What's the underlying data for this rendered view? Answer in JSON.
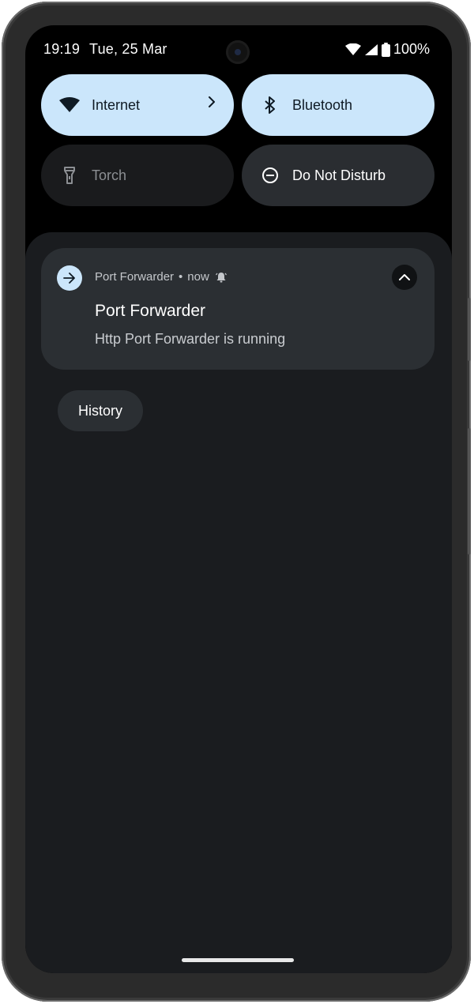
{
  "status_bar": {
    "time": "19:19",
    "date": "Tue, 25 Mar",
    "battery": "100%",
    "icons": [
      "wifi-icon",
      "cellular-signal-icon",
      "battery-icon"
    ]
  },
  "quick_tiles": [
    {
      "label": "Internet",
      "icon": "wifi-icon",
      "state": "on",
      "has_chevron": true
    },
    {
      "label": "Bluetooth",
      "icon": "bluetooth-icon",
      "state": "on"
    },
    {
      "label": "Torch",
      "icon": "torch-icon",
      "state": "off"
    },
    {
      "label": "Do Not Disturb",
      "icon": "dnd-icon",
      "state": "off"
    }
  ],
  "notification": {
    "app_name": "Port Forwarder",
    "separator": "•",
    "time": "now",
    "title": "Port Forwarder",
    "text": "Http Port Forwarder is running",
    "app_icon": "arrow-right-icon",
    "header_icon": "alert-bell-icon",
    "expand_icon": "chevron-up-icon"
  },
  "history_button": {
    "label": "History"
  },
  "colors": {
    "tile_on": "#cbe6fb",
    "tile_off": "#1a1b1d",
    "tile_mid": "#2a2d31",
    "shade_bg": "#1a1c1f",
    "card_bg": "#2b2f33"
  }
}
